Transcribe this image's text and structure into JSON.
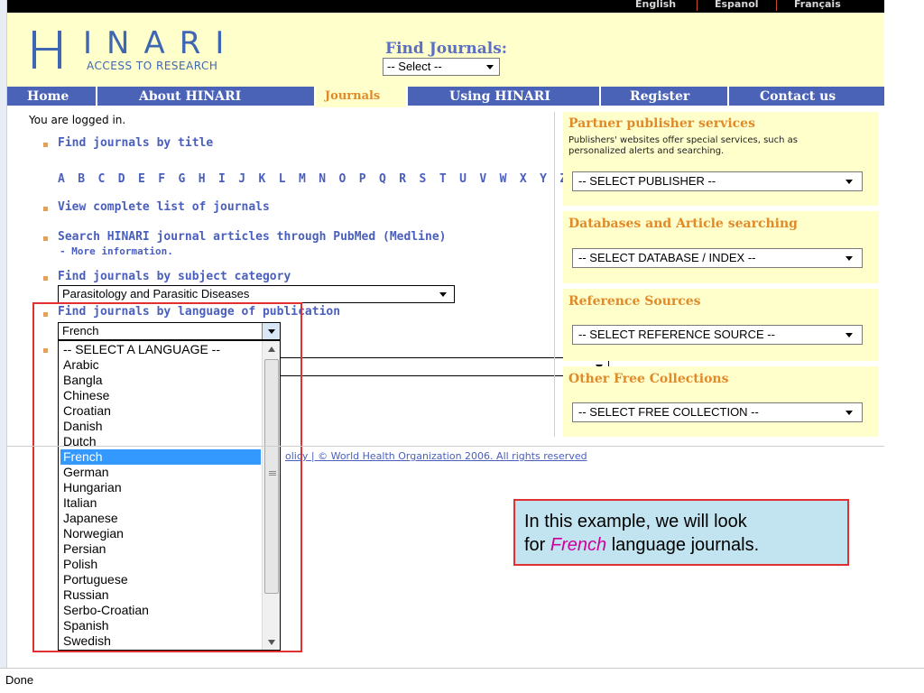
{
  "languages": {
    "english": "English",
    "espanol": "Espanol",
    "francais": "Français"
  },
  "logo": {
    "name": "HINARI",
    "tagline": "ACCESS TO RESEARCH"
  },
  "find_journals": {
    "title": "Find Journals:",
    "select_value": "-- Select --"
  },
  "nav": {
    "items": [
      "Home",
      "About HINARI",
      "Journals",
      "Using HINARI",
      "Register",
      "Contact us"
    ],
    "active": "Journals"
  },
  "main": {
    "logged_in": "You are logged in.",
    "find_by_title": "Find journals by title",
    "alphabet": "A B C D E F G H I J K L M N O P Q R S T U V W X Y Z",
    "view_complete": "View complete list of journals",
    "search_pubmed": "Search HINARI journal articles through PubMed (Medline)",
    "more_info": "- More information.",
    "find_by_subject": "Find journals by subject category",
    "subject_value": "Parasitology and Parasitic Diseases",
    "find_by_language": "Find journals by language of publication",
    "language_value": "French",
    "language_options": [
      "-- SELECT A LANGUAGE --",
      "Arabic",
      "Bangla",
      "Chinese",
      "Croatian",
      "Danish",
      "Dutch",
      "French",
      "German",
      "Hungarian",
      "Italian",
      "Japanese",
      "Norwegian",
      "Persian",
      "Polish",
      "Portuguese",
      "Russian",
      "Serbo-Croatian",
      "Spanish",
      "Swedish"
    ],
    "language_selected": "French"
  },
  "sidebar": {
    "partner": {
      "title": "Partner publisher services",
      "desc_line1": "Publishers' websites offer special services, such as",
      "desc_line2": "personalized alerts and searching.",
      "select": "-- SELECT PUBLISHER --"
    },
    "databases": {
      "title": "Databases and Article searching",
      "select": "-- SELECT DATABASE / INDEX --"
    },
    "reference": {
      "title": "Reference Sources",
      "select": "-- SELECT REFERENCE SOURCE --"
    },
    "free": {
      "title": "Other Free Collections",
      "select": "-- SELECT FREE COLLECTION --"
    }
  },
  "footer": {
    "text": "olicy | © World Health Organization 2006. All rights reserved"
  },
  "callout": {
    "pre": "In this example, we will look",
    "for": "for",
    "em": "French",
    "post": "language journals."
  },
  "status": {
    "text": "Done"
  },
  "colors": {
    "header_bg": "#ffffcc",
    "nav_bg": "#4b63b7",
    "link": "#4a5fbd",
    "sidebar_title": "#e08a2a",
    "selection": "#3399ff",
    "callout_bg": "#c2e4f0",
    "frame_red": "#e03030"
  }
}
